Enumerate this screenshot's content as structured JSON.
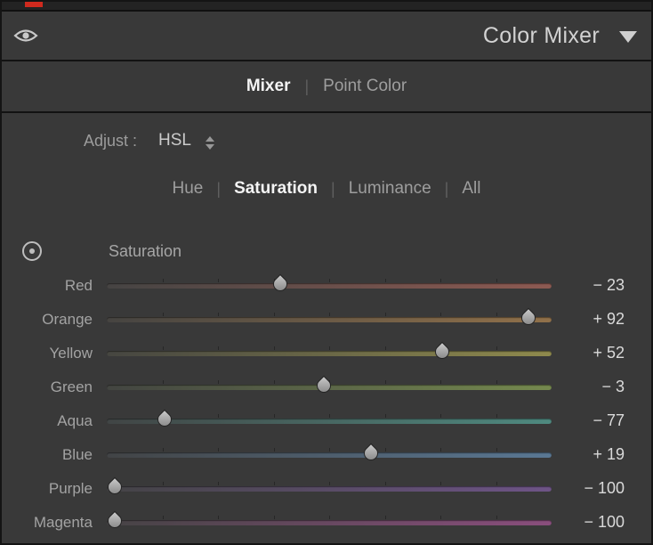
{
  "top": {
    "accent_marker_color": "#cf2a1e"
  },
  "header": {
    "title": "Color Mixer"
  },
  "tabs": {
    "separator": "|",
    "items": [
      {
        "label": "Mixer",
        "active": true
      },
      {
        "label": "Point Color",
        "active": false
      }
    ]
  },
  "adjust": {
    "label": "Adjust :",
    "value": "HSL"
  },
  "mode_tabs": {
    "separator": "|",
    "items": [
      {
        "label": "Hue",
        "active": false
      },
      {
        "label": "Saturation",
        "active": true
      },
      {
        "label": "Luminance",
        "active": false
      },
      {
        "label": "All",
        "active": false
      }
    ]
  },
  "section": {
    "title": "Saturation"
  },
  "sliders": {
    "range_min": -100,
    "range_max": 100,
    "items": [
      {
        "name": "Red",
        "value": -23,
        "display": "− 23",
        "track_left": "#464443",
        "track_right": "#8d5a52"
      },
      {
        "name": "Orange",
        "value": 92,
        "display": "+ 92",
        "track_left": "#464441",
        "track_right": "#91714a"
      },
      {
        "name": "Yellow",
        "value": 52,
        "display": "+ 52",
        "track_left": "#464641",
        "track_right": "#8f8a4d"
      },
      {
        "name": "Green",
        "value": -3,
        "display": "− 3",
        "track_left": "#434541",
        "track_right": "#75894e"
      },
      {
        "name": "Aqua",
        "value": -77,
        "display": "− 77",
        "track_left": "#414545",
        "track_right": "#4f8a80"
      },
      {
        "name": "Blue",
        "value": 19,
        "display": "+ 19",
        "track_left": "#424446",
        "track_right": "#5a7894"
      },
      {
        "name": "Purple",
        "value": -100,
        "display": "− 100",
        "track_left": "#444346",
        "track_right": "#6e5487"
      },
      {
        "name": "Magenta",
        "value": -100,
        "display": "− 100",
        "track_left": "#464345",
        "track_right": "#8a4e7d"
      }
    ]
  }
}
